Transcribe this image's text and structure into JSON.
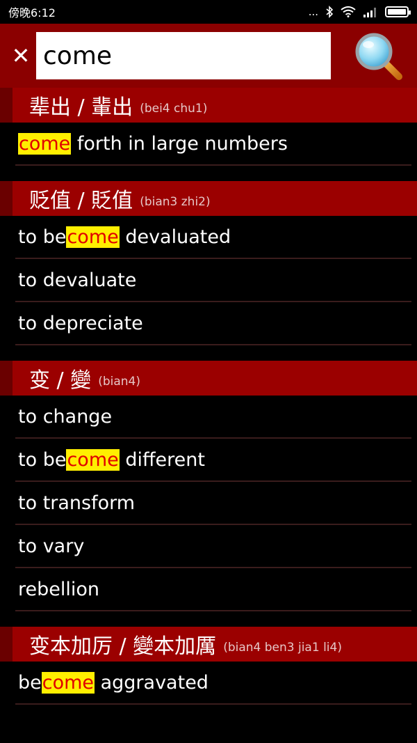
{
  "status_bar": {
    "time": "傍晚6:12",
    "dots": "...",
    "bluetooth": "bluetooth-icon",
    "wifi": "wifi-icon",
    "signal": "signal-icon",
    "battery": "battery-icon"
  },
  "search": {
    "value": "come",
    "close_label": "✕"
  },
  "entries": [
    {
      "title": "辈出 / 輩出",
      "pinyin": "(bei4 chu1)",
      "defs": [
        {
          "pre": "",
          "hl": "come",
          "post": " forth in large numbers"
        }
      ]
    },
    {
      "title": "贬值 / 貶值",
      "pinyin": "(bian3 zhi2)",
      "defs": [
        {
          "pre": "to be",
          "hl": "come",
          "post": " devaluated"
        },
        {
          "pre": "to devaluate",
          "hl": "",
          "post": ""
        },
        {
          "pre": "to depreciate",
          "hl": "",
          "post": ""
        }
      ]
    },
    {
      "title": "变 / 變",
      "pinyin": "(bian4)",
      "defs": [
        {
          "pre": "to change",
          "hl": "",
          "post": ""
        },
        {
          "pre": "to be",
          "hl": "come",
          "post": " different"
        },
        {
          "pre": "to transform",
          "hl": "",
          "post": ""
        },
        {
          "pre": "to vary",
          "hl": "",
          "post": ""
        },
        {
          "pre": "rebellion",
          "hl": "",
          "post": ""
        }
      ]
    },
    {
      "title": "变本加厉 / 變本加厲",
      "pinyin": "(bian4 ben3 jia1 li4)",
      "defs": [
        {
          "pre": "be",
          "hl": "come",
          "post": " aggravated"
        }
      ]
    }
  ]
}
